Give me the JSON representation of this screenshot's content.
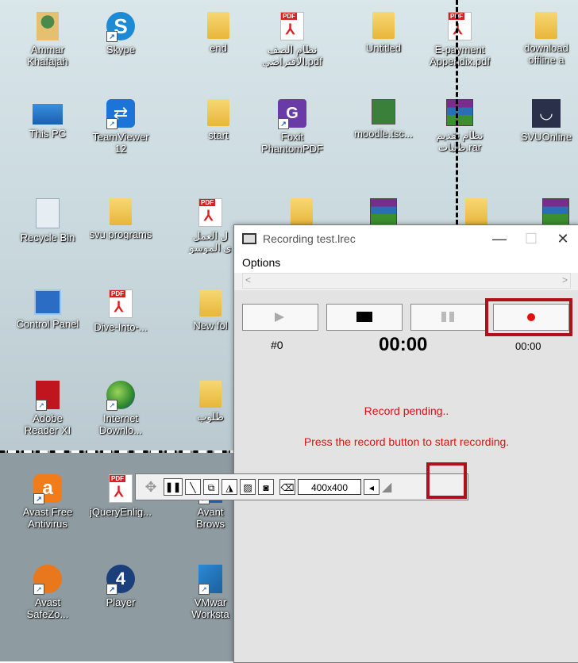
{
  "desktop": {
    "icons": [
      {
        "label": "Ammar\nKhafajah",
        "icon": "user-folder-icon"
      },
      {
        "label": "Skype",
        "icon": "skype-icon"
      },
      {
        "label": "end",
        "icon": "folder-icon"
      },
      {
        "label": "نظام الصف\nالافتراضي.pdf",
        "icon": "pdf-icon"
      },
      {
        "label": "Untitled",
        "icon": "folder-icon"
      },
      {
        "label": "E-payment\nAppendix.pdf",
        "icon": "pdf-icon"
      },
      {
        "label": "download\noffline a",
        "icon": "file-icon"
      },
      {
        "label": "This PC",
        "icon": "computer-icon"
      },
      {
        "label": "TeamViewer\n12",
        "icon": "teamviewer-icon"
      },
      {
        "label": "start",
        "icon": "folder-icon"
      },
      {
        "label": "Foxit\nPhantomPDF",
        "icon": "foxit-icon"
      },
      {
        "label": "moodle.tsc...",
        "icon": "video-file-icon"
      },
      {
        "label": "نظام تقديم\nطلبات.rar",
        "icon": "rar-icon"
      },
      {
        "label": "SVUOnline",
        "icon": "svu-icon"
      },
      {
        "label": "Recycle Bin",
        "icon": "recycle-bin-icon"
      },
      {
        "label": "svu programs",
        "icon": "folder-icon"
      },
      {
        "label": "ل العمل\nى الموسو",
        "icon": "pdf-icon"
      },
      {
        "label": "",
        "icon": "folder-icon"
      },
      {
        "label": "",
        "icon": "rar-icon"
      },
      {
        "label": "",
        "icon": "folder-icon"
      },
      {
        "label": "",
        "icon": "rar-icon"
      },
      {
        "label": "Control Panel",
        "icon": "control-panel-icon"
      },
      {
        "label": "Dive-Into-...",
        "icon": "pdf-icon"
      },
      {
        "label": "New fol",
        "icon": "folder-icon"
      },
      {
        "label": "Adobe\nReader XI",
        "icon": "adobe-reader-icon"
      },
      {
        "label": "Internet\nDownlo...",
        "icon": "internet-download-icon"
      },
      {
        "label": "طلوب",
        "icon": "folder-icon"
      },
      {
        "label": "Avast Free\nAntivirus",
        "icon": "avast-icon"
      },
      {
        "label": "jQueryEnlig...",
        "icon": "pdf-icon"
      },
      {
        "label": "Avant\nBrows",
        "icon": "browser-icon"
      },
      {
        "label": "Avast\nSafeZo...",
        "icon": "avast-safezone-icon"
      },
      {
        "label": "Player",
        "icon": "player-icon"
      },
      {
        "label": "VMwar\nWorksta",
        "icon": "vmware-icon"
      }
    ]
  },
  "window": {
    "title": "Recording test.lrec",
    "minimize": "—",
    "maximize": "☐",
    "close": "✕",
    "menu": [
      "Options"
    ],
    "scroll_left": "<",
    "scroll_right": ">",
    "counter": "#0",
    "time": "00:00",
    "record_time": "00:00",
    "status_line1": "Record pending..",
    "status_line2": "Press the record button to start recording.",
    "accent_red": "#e01010",
    "highlight_red": "#b0101c"
  },
  "toolbar": {
    "size_value": "400x400"
  }
}
